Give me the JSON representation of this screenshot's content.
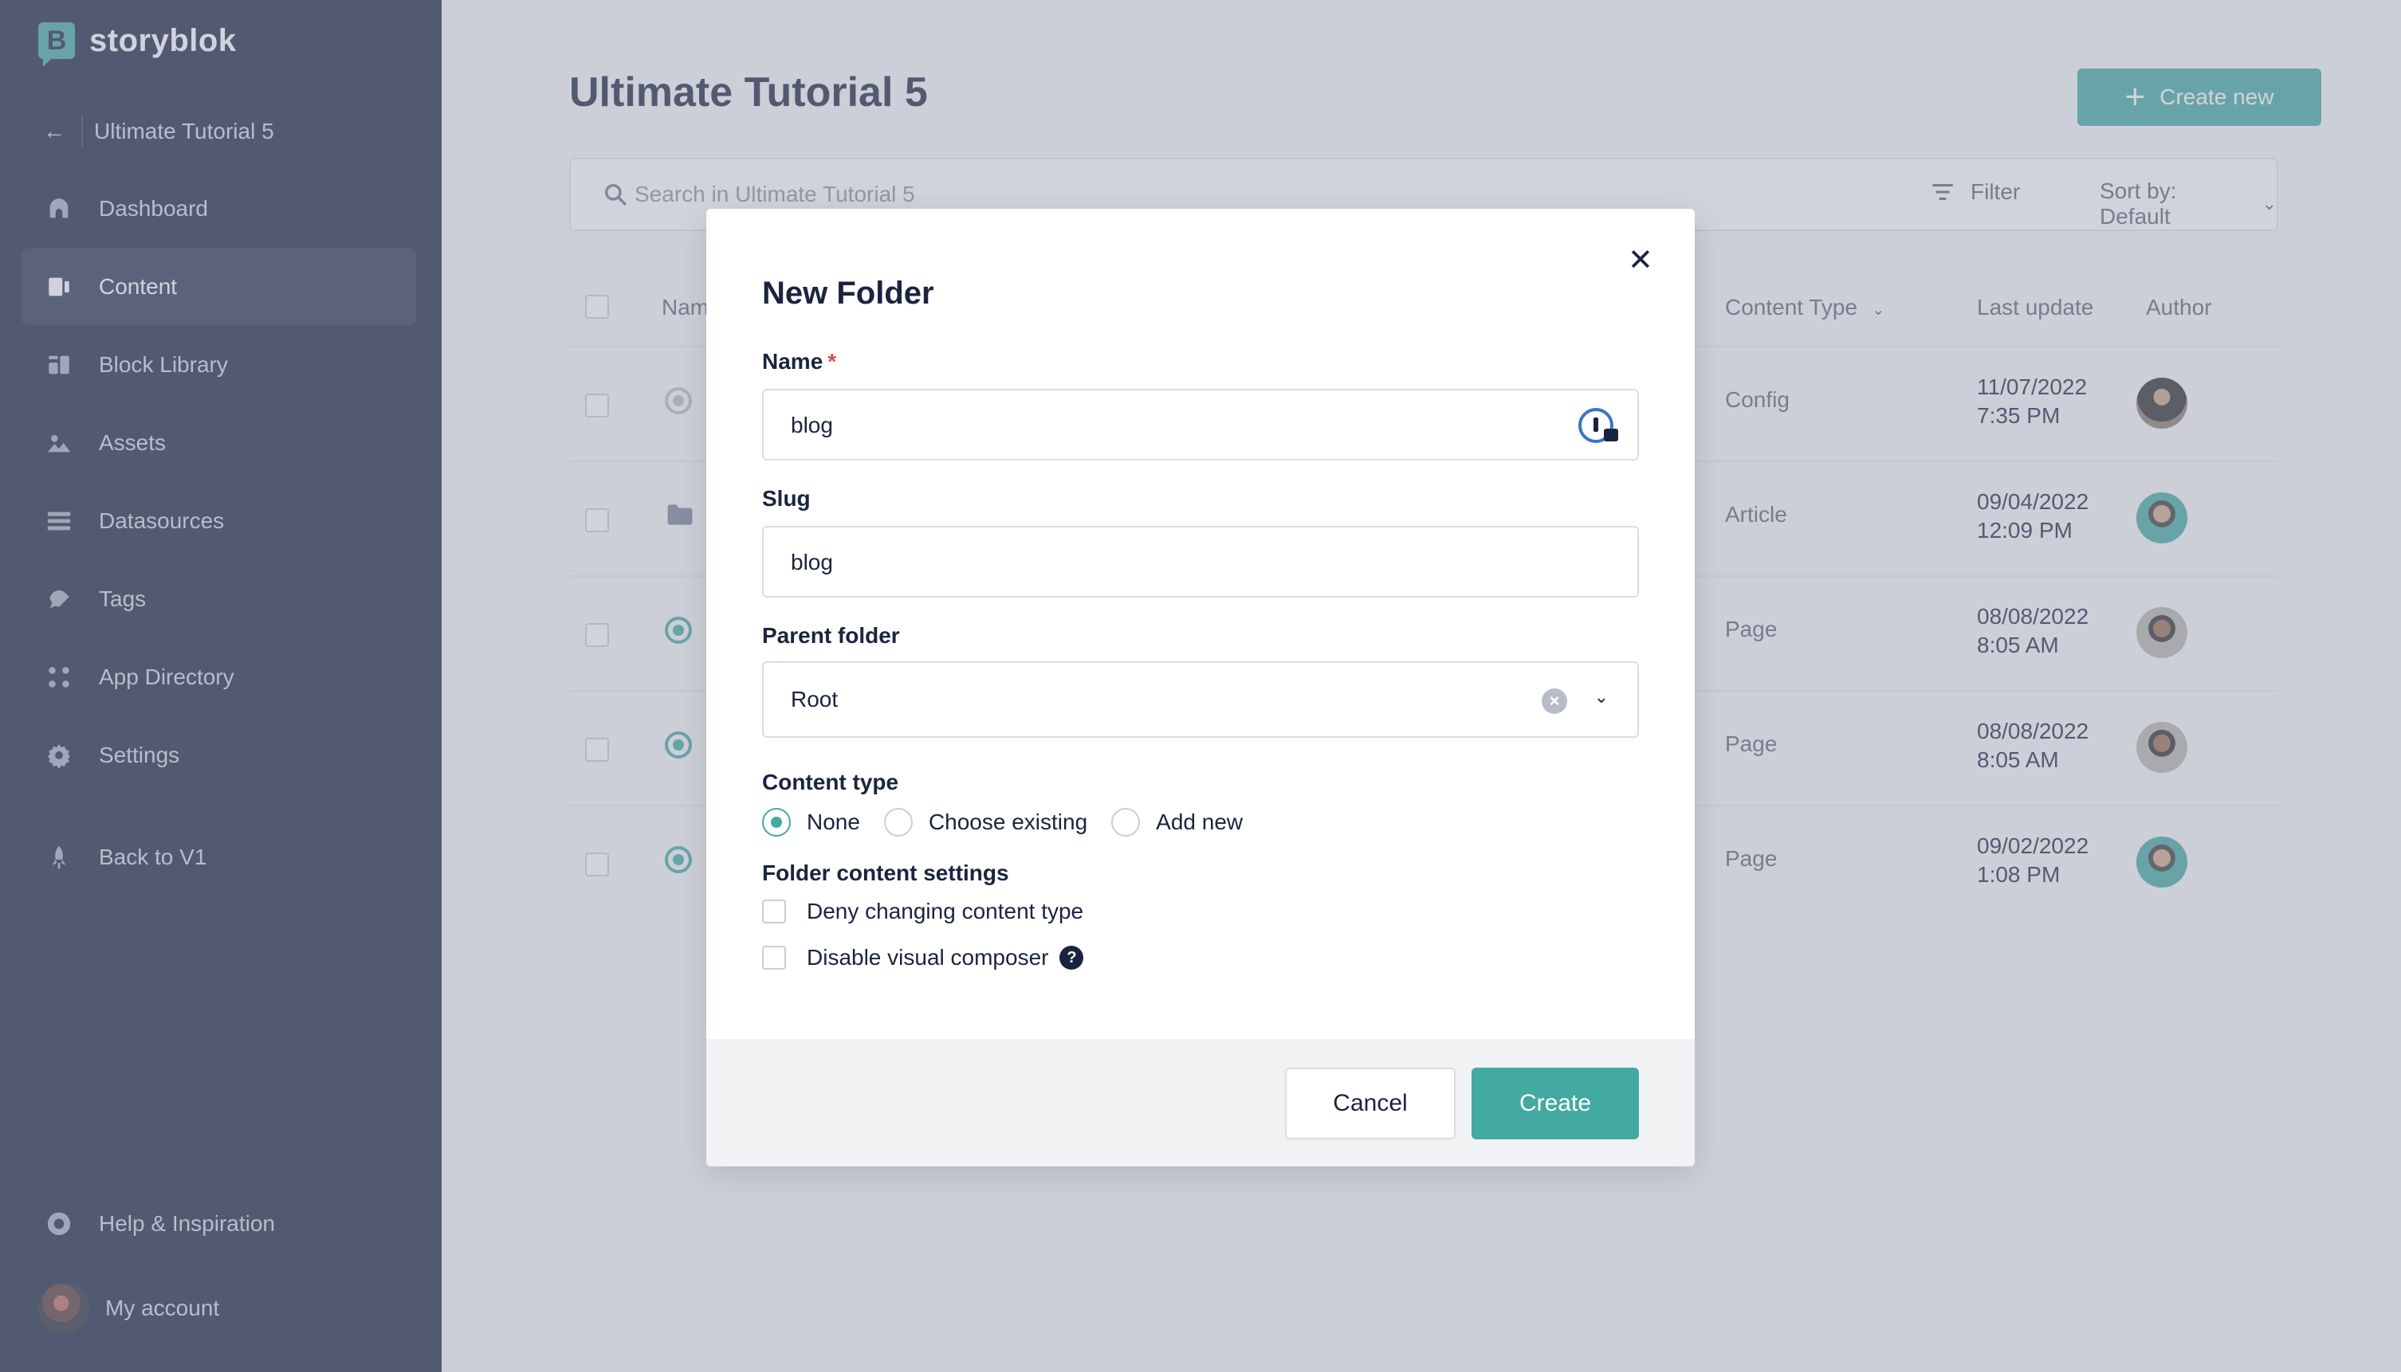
{
  "sidebar": {
    "logo_text": "storyblok",
    "logo_mark": "B",
    "space_name": "Ultimate Tutorial 5",
    "items": [
      {
        "label": "Dashboard",
        "icon": "dashboard-icon"
      },
      {
        "label": "Content",
        "icon": "content-icon",
        "active": true
      },
      {
        "label": "Block Library",
        "icon": "block-library-icon"
      },
      {
        "label": "Assets",
        "icon": "assets-icon"
      },
      {
        "label": "Datasources",
        "icon": "datasources-icon"
      },
      {
        "label": "Tags",
        "icon": "tags-icon"
      },
      {
        "label": "App Directory",
        "icon": "app-directory-icon"
      },
      {
        "label": "Settings",
        "icon": "gear-icon"
      },
      {
        "label": "Back to V1",
        "icon": "rocket-icon"
      },
      {
        "label": "Help & Inspiration",
        "icon": "lifebuoy-icon"
      }
    ],
    "account_label": "My account"
  },
  "main": {
    "title": "Ultimate Tutorial 5",
    "create_new_label": "Create new",
    "search_placeholder": "Search in Ultimate Tutorial 5",
    "filter_label": "Filter",
    "sort_label": "Sort by: Default",
    "columns": {
      "name": "Name",
      "content_type": "Content Type",
      "last_update": "Last update",
      "author": "Author"
    },
    "rows": [
      {
        "content_type": "Config",
        "date": "11/07/2022",
        "time": "7:35 PM",
        "status": "draft"
      },
      {
        "content_type": "Article",
        "date": "09/04/2022",
        "time": "12:09 PM",
        "status": "folder"
      },
      {
        "content_type": "Page",
        "date": "08/08/2022",
        "time": "8:05 AM",
        "status": "published"
      },
      {
        "content_type": "Page",
        "date": "08/08/2022",
        "time": "8:05 AM",
        "status": "published"
      },
      {
        "content_type": "Page",
        "date": "09/02/2022",
        "time": "1:08 PM",
        "status": "published"
      }
    ]
  },
  "modal": {
    "title": "New Folder",
    "close_glyph": "✕",
    "name_label": "Name",
    "required_mark": "*",
    "name_value": "blog",
    "slug_label": "Slug",
    "slug_value": "blog",
    "parent_label": "Parent folder",
    "parent_value": "Root",
    "content_type_label": "Content type",
    "content_type_options": [
      "None",
      "Choose existing",
      "Add new"
    ],
    "content_type_selected": "None",
    "settings_label": "Folder content settings",
    "settings_options": [
      "Deny changing content type",
      "Disable visual composer"
    ],
    "help_glyph": "?",
    "cancel_label": "Cancel",
    "create_label": "Create"
  },
  "colors": {
    "accent": "#43aaa1",
    "sidebar_bg": "#1b243f",
    "text": "#1b243f"
  }
}
